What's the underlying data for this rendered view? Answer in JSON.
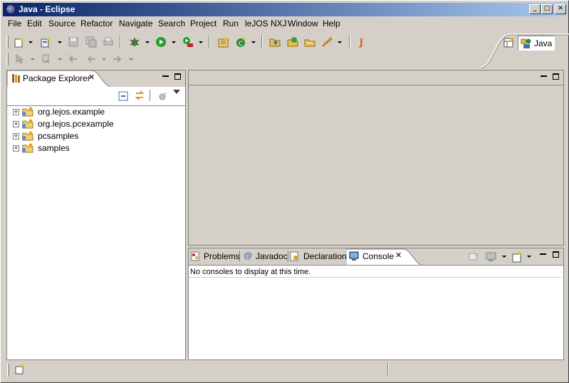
{
  "window": {
    "title": "Java - Eclipse",
    "minimize_label": "_",
    "restore_label": "□",
    "close_label": "✕"
  },
  "menu": [
    "File",
    "Edit",
    "Source",
    "Refactor",
    "Navigate",
    "Search",
    "Project",
    "Run",
    "leJOS NXJ",
    "Window",
    "Help"
  ],
  "perspective": {
    "label": "Java"
  },
  "package_explorer": {
    "title": "Package Explorer",
    "projects": [
      {
        "label": "org.lejos.example"
      },
      {
        "label": "org.lejos.pcexample"
      },
      {
        "label": "pcsamples"
      },
      {
        "label": "samples"
      }
    ]
  },
  "bottom_tabs": [
    {
      "label": "Problems"
    },
    {
      "label": "Javadoc"
    },
    {
      "label": "Declaration"
    },
    {
      "label": "Console",
      "active": true
    }
  ],
  "console": {
    "message": "No consoles to display at this time."
  },
  "colors": {
    "title_start": "#0a246a",
    "title_end": "#a6caf0",
    "chrome": "#d4d0c8",
    "active_tab": "#ffffff"
  },
  "icons": {
    "expander_plus": "+",
    "close_x": "✕"
  }
}
